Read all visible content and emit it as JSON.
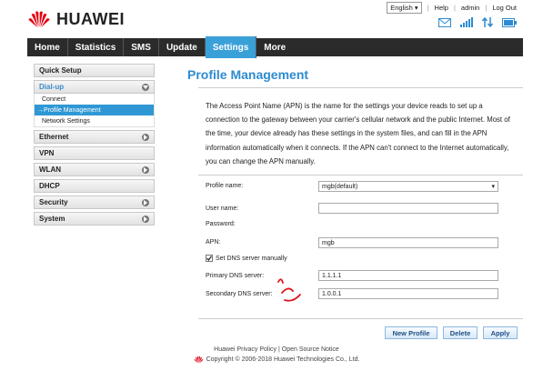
{
  "brand": {
    "name": "HUAWEI",
    "color": "#e60012"
  },
  "toplinks": {
    "language": "English",
    "help": "Help",
    "user": "admin",
    "logout": "Log Out"
  },
  "status_icons": [
    "mail-icon",
    "signal-icon",
    "transfer-icon",
    "battery-icon"
  ],
  "nav": {
    "items": [
      "Home",
      "Statistics",
      "SMS",
      "Update",
      "Settings",
      "More"
    ],
    "active": "Settings",
    "accent": "#3aa0d8"
  },
  "sidebar": {
    "quick_setup": "Quick Setup",
    "dialup": "Dial-up",
    "dialup_subs": [
      "Connect",
      "Profile Management",
      "Network Settings"
    ],
    "ethernet": "Ethernet",
    "vpn": "VPN",
    "wlan": "WLAN",
    "dhcp": "DHCP",
    "security": "Security",
    "system": "System"
  },
  "main": {
    "title": "Profile Management",
    "description": "The Access Point Name (APN) is the name for the settings your device reads to set up a connection to the gateway between your carrier's cellular network and the public Internet. Most of the time, your device already has these settings in the system files, and can fill in the APN information automatically when it connects. If the APN can't connect to the Internet automatically, you can change the APN manually.",
    "form": {
      "profile_label": "Profile name:",
      "profile_value": "mgb(default)",
      "username_label": "User name:",
      "username_value": "",
      "password_label": "Password:",
      "apn_label": "APN:",
      "apn_value": "mgb",
      "dns_manual_label": "Set DNS server manually",
      "dns_manual_checked": true,
      "primary_dns_label": "Primary DNS server:",
      "primary_dns_value": "1.1.1.1",
      "secondary_dns_label": "Secondary DNS server:",
      "secondary_dns_value": "1.0.0.1"
    },
    "buttons": {
      "new_profile": "New Profile",
      "delete": "Delete",
      "apply": "Apply"
    }
  },
  "footer": {
    "privacy": "Huawei Privacy Policy",
    "sep": "|",
    "open_source": "Open Source Notice",
    "copyright": "Copyright © 2006-2018 Huawei Technologies Co., Ltd."
  }
}
